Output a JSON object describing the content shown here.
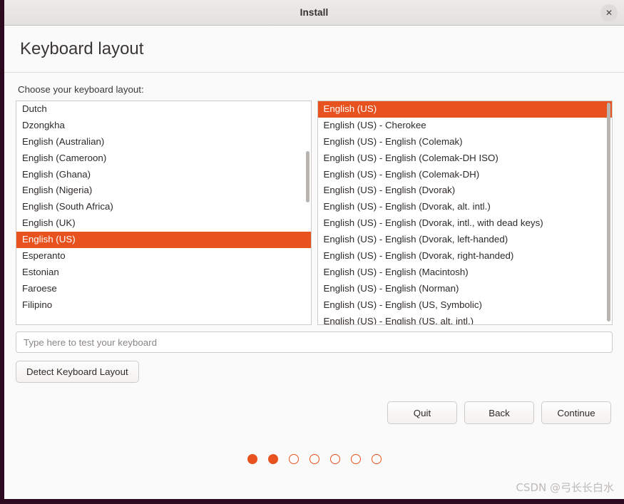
{
  "window": {
    "title": "Install",
    "close_icon": "close-icon"
  },
  "page": {
    "heading": "Keyboard layout",
    "choose_label": "Choose your keyboard layout:"
  },
  "layout_list": {
    "selected": "English (US)",
    "items": [
      "Dutch",
      "Dzongkha",
      "English (Australian)",
      "English (Cameroon)",
      "English (Ghana)",
      "English (Nigeria)",
      "English (South Africa)",
      "English (UK)",
      "English (US)",
      "Esperanto",
      "Estonian",
      "Faroese",
      "Filipino"
    ]
  },
  "variant_list": {
    "selected": "English (US)",
    "items": [
      "English (US)",
      "English (US) - Cherokee",
      "English (US) - English (Colemak)",
      "English (US) - English (Colemak-DH ISO)",
      "English (US) - English (Colemak-DH)",
      "English (US) - English (Dvorak)",
      "English (US) - English (Dvorak, alt. intl.)",
      "English (US) - English (Dvorak, intl., with dead keys)",
      "English (US) - English (Dvorak, left-handed)",
      "English (US) - English (Dvorak, right-handed)",
      "English (US) - English (Macintosh)",
      "English (US) - English (Norman)",
      "English (US) - English (US, Symbolic)",
      "English (US) - English (US, alt. intl.)"
    ]
  },
  "test_field": {
    "placeholder": "Type here to test your keyboard",
    "value": ""
  },
  "buttons": {
    "detect": "Detect Keyboard Layout",
    "quit": "Quit",
    "back": "Back",
    "continue": "Continue"
  },
  "progress": {
    "total": 7,
    "filled": 2
  },
  "watermark": "CSDN @弓长长白水",
  "colors": {
    "accent": "#e8521f",
    "desktop": "#2c0a1f",
    "titlebar": "#e8e6e4"
  }
}
